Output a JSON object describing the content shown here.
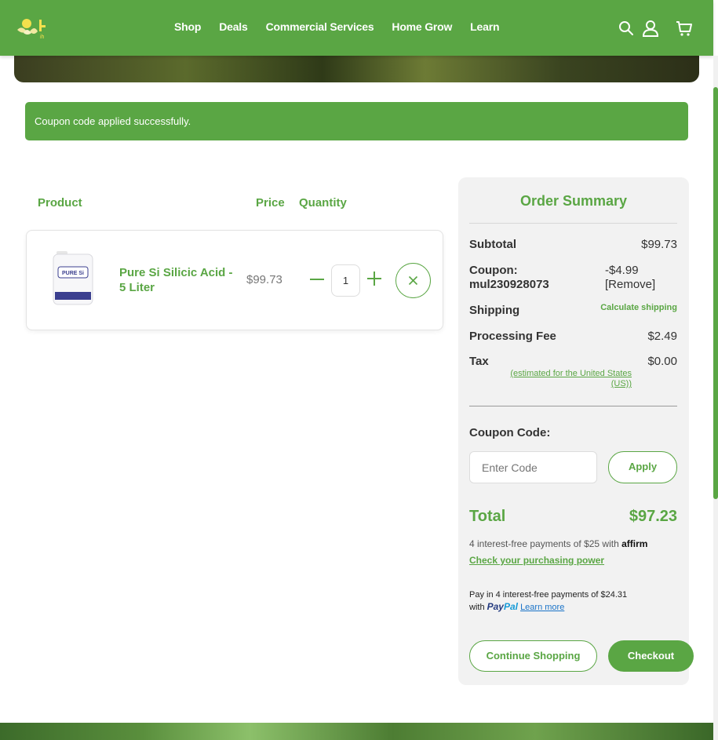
{
  "header": {
    "nav": [
      "Shop",
      "Deals",
      "Commercial Services",
      "Home Grow",
      "Learn"
    ],
    "icons": [
      "search-icon",
      "user-icon",
      "cart-icon"
    ],
    "logo_sub": "ih"
  },
  "alert": {
    "message": "Coupon code applied successfully."
  },
  "cart": {
    "columns": {
      "product": "Product",
      "price": "Price",
      "quantity": "Quantity"
    },
    "item": {
      "name": "Pure Si Silicic Acid - 5 Liter",
      "image_text": "PURE Si",
      "price": "$99.73",
      "quantity": "1"
    }
  },
  "summary": {
    "title": "Order Summary",
    "subtotal_label": "Subtotal",
    "subtotal_value": "$99.73",
    "coupon_label": "Coupon:",
    "coupon_code": "mul230928073",
    "coupon_value": "-$4.99",
    "coupon_remove": "[Remove]",
    "shipping_label": "Shipping",
    "shipping_value": "Calculate shipping",
    "fee_label": "Processing Fee",
    "fee_value": "$2.49",
    "tax_label": "Tax",
    "tax_value": "$0.00",
    "tax_note_1": "(estimated for the United States",
    "tax_note_2": "(US))",
    "coupon_code_label": "Coupon Code:",
    "coupon_placeholder": "Enter Code",
    "apply_label": "Apply",
    "total_label": "Total",
    "total_value": "$97.23",
    "affirm_text": "4 interest-free payments of $25 with",
    "affirm_brand": "affirm",
    "affirm_link": "Check your purchasing power",
    "paypal_line1": "Pay in 4 interest-free payments of $24.31",
    "paypal_with": "with",
    "paypal_brand_1": "Pay",
    "paypal_brand_2": "Pal",
    "paypal_learn": "Learn more",
    "continue_label": "Continue Shopping",
    "checkout_label": "Checkout"
  },
  "colors": {
    "brand_green": "#5aa644",
    "summary_bg": "#f2f2f2",
    "paypal_blue": "#253b80"
  }
}
